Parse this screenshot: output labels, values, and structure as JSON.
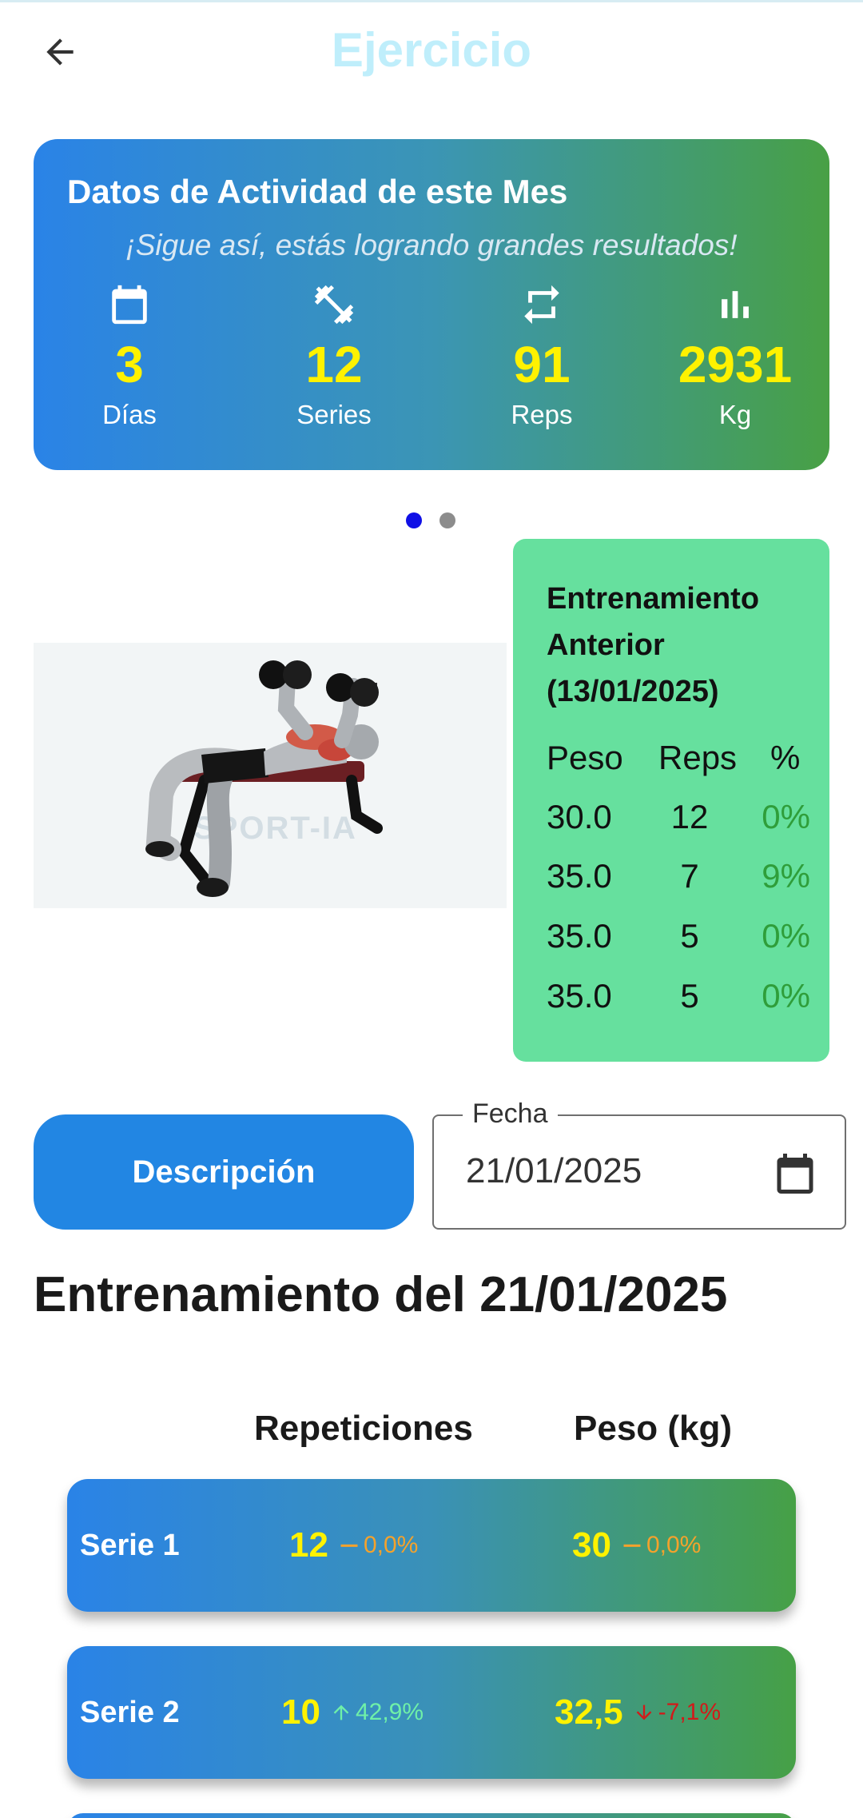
{
  "header": {
    "title": "Ejercicio"
  },
  "stats": {
    "title": "Datos de Actividad de este Mes",
    "subtitle": "¡Sigue así, estás logrando grandes resultados!",
    "items": [
      {
        "icon": "calendar-icon",
        "value": "3",
        "label": "Días"
      },
      {
        "icon": "dumbbell-icon",
        "value": "12",
        "label": "Series"
      },
      {
        "icon": "repeat-icon",
        "value": "91",
        "label": "Reps"
      },
      {
        "icon": "bar-chart-icon",
        "value": "2931",
        "label": "Kg"
      }
    ]
  },
  "carousel": {
    "pages": 2,
    "active": 0
  },
  "exercise_image": {
    "watermark": "SPORT-IA"
  },
  "previous": {
    "title": "Entrenamiento Anterior (13/01/2025)",
    "headers": [
      "Peso",
      "Reps",
      "%"
    ],
    "rows": [
      {
        "peso": "30.0",
        "reps": "12",
        "pct": "0%"
      },
      {
        "peso": "35.0",
        "reps": "7",
        "pct": "9%"
      },
      {
        "peso": "35.0",
        "reps": "5",
        "pct": "0%"
      },
      {
        "peso": "35.0",
        "reps": "5",
        "pct": "0%"
      }
    ]
  },
  "description_button": "Descripción",
  "date_field": {
    "label": "Fecha",
    "value": "21/01/2025"
  },
  "workout": {
    "title": "Entrenamiento del 21/01/2025",
    "col_reps": "Repeticiones",
    "col_weight": "Peso (kg)",
    "series": [
      {
        "label": "Serie 1",
        "reps": "12",
        "reps_delta": "0,0%",
        "reps_trend": "neutral",
        "weight": "30",
        "weight_delta": "0,0%",
        "weight_trend": "neutral"
      },
      {
        "label": "Serie 2",
        "reps": "10",
        "reps_delta": "42,9%",
        "reps_trend": "up",
        "weight": "32,5",
        "weight_delta": "-7,1%",
        "weight_trend": "down"
      }
    ]
  },
  "colors": {
    "accent": "#2286e3",
    "gain": "#2f9e3a",
    "highlight": "#fff200",
    "prev_bg": "#66e09e"
  }
}
